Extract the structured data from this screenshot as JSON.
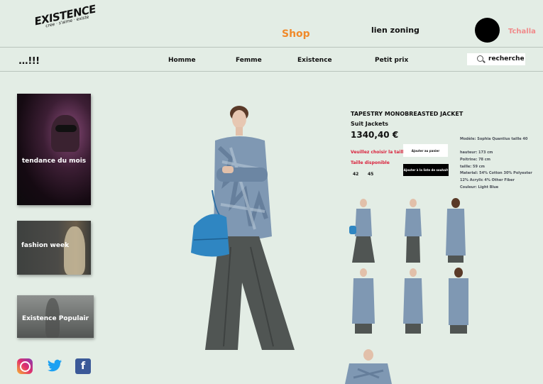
{
  "header": {
    "logo_main": "EXISTENCE",
    "logo_sub": "cree · s'aime · existe",
    "shop": "Shop",
    "lien": "lien zoning",
    "username": "Tchalla"
  },
  "menu": {
    "logo": "...!!!",
    "items": [
      "Homme",
      "Femme",
      "Existence",
      "Petit prix"
    ],
    "search_placeholder": "recherche"
  },
  "side_cards": [
    {
      "label": "tendance du mois"
    },
    {
      "label": "fashion week"
    },
    {
      "label": "Existence Populair"
    }
  ],
  "product": {
    "title": "TAPESTRY MONOBREASTED JACKET",
    "category": "Suit Jackets",
    "price": "1340,40 €",
    "size_prompt": "Veuillez choisir la taille",
    "size_available": "Taille disponible",
    "sizes": [
      "42",
      "45"
    ],
    "add_to_cart": "Ajouter au panier",
    "add_to_wishlist": "Ajouter à la liste de souhait"
  },
  "specs": [
    "Modèle: Sophia Quantius taille 40",
    "hauteur: 173 cm",
    "Poitrine: 78 cm",
    "taille: 59 cm",
    "Material: 54% Cotton 30% Polyester",
    "12% Acrylic 4% Other Fiber",
    "Couleur: Light Blue"
  ],
  "colors": {
    "accent": "#f08a2a",
    "username": "#f08a8a",
    "warning": "#d9203b",
    "background": "#e3ede5"
  }
}
